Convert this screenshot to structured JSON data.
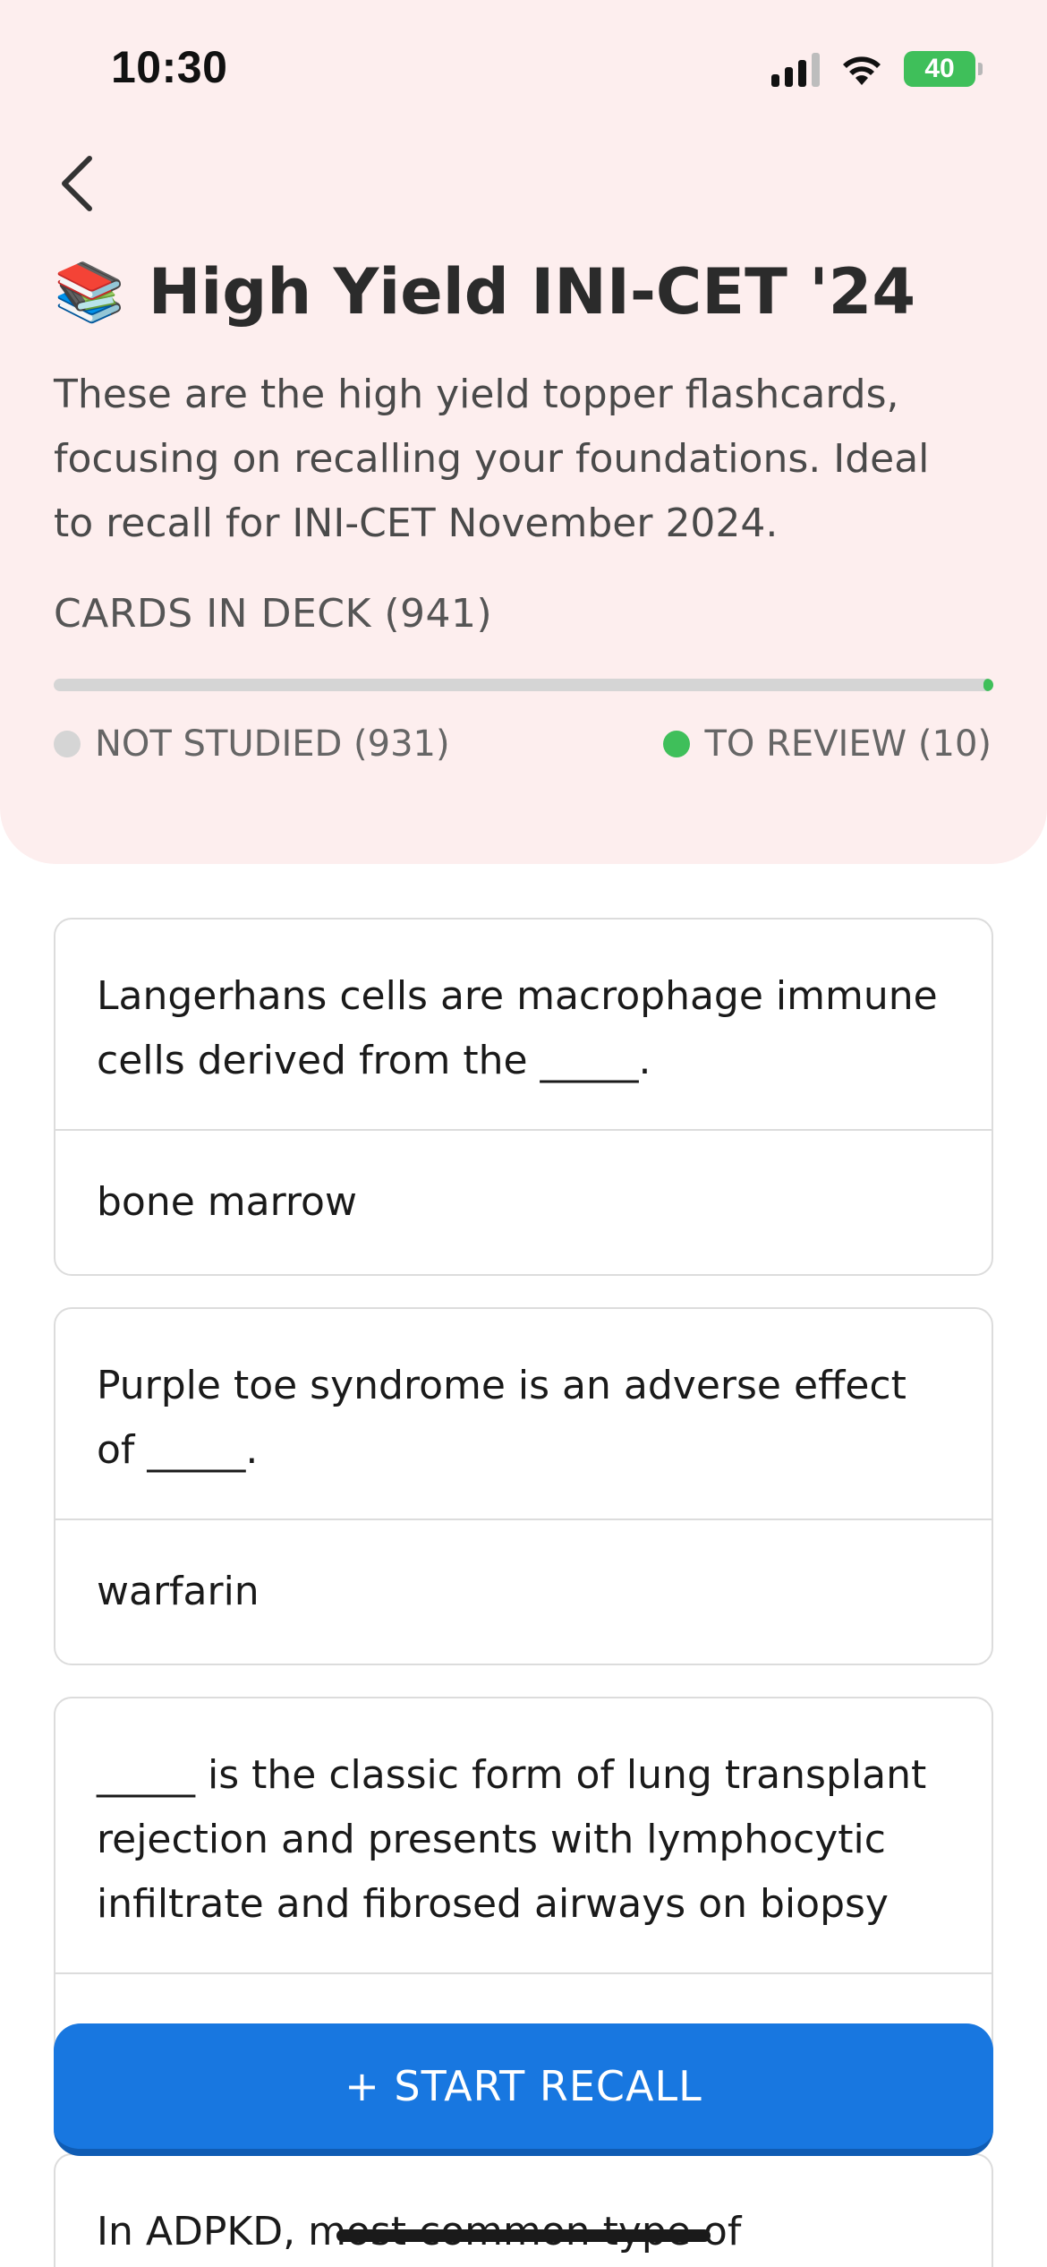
{
  "status_bar": {
    "time": "10:30",
    "battery": "40"
  },
  "header": {
    "emoji": "📚",
    "title": "High Yield INI-CET '24",
    "description": "These are the high yield topper flashcards, focusing on recalling your foundations. Ideal to recall for INI-CET November 2024.",
    "cards_label": "CARDS IN DECK (941)",
    "progress_reviewed_fraction": 0.0106,
    "not_studied_label": "NOT STUDIED (931)",
    "to_review_label": "TO REVIEW (10)",
    "colors": {
      "background": "#fdeeee",
      "not_studied": "#d5d5d5",
      "to_review": "#3fbf5a"
    }
  },
  "cards": [
    {
      "question": "Langerhans cells are macrophage immune cells derived from the _____.",
      "answer": "bone marrow"
    },
    {
      "question": "Purple toe syndrome is an adverse effect of _____.",
      "answer": "warfarin"
    },
    {
      "question": "_____ is the classic form of lung transplant rejection and presents with lymphocytic infiltrate and fibrosed airways on biopsy",
      "answer": ""
    },
    {
      "question": "In ADPKD, most common type of intracranial",
      "answer": ""
    }
  ],
  "actions": {
    "start_recall": "+ START RECALL",
    "accent": "#1877e0"
  }
}
